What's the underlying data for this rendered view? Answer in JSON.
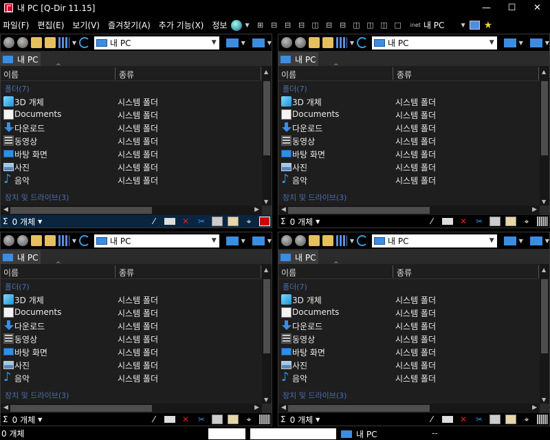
{
  "window": {
    "title": "내 PC  [Q-Dir 11.15]",
    "min": "—",
    "max": "☐",
    "close": "✕"
  },
  "menu": {
    "items": [
      "파일(F)",
      "편집(E)",
      "보기(V)",
      "즐겨찾기(A)",
      "추가 기능(X)",
      "정보"
    ],
    "pc_label": "내 PC"
  },
  "pane": {
    "address": "내 PC",
    "tab_label": "내 PC",
    "col_name": "이름",
    "col_type": "종류",
    "group_folders": "폴더(7)",
    "group_drives": "장치 및 드라이브(3)",
    "rows": [
      {
        "name": "3D 개체",
        "type": "시스템 폴더",
        "icon": "cube"
      },
      {
        "name": "Documents",
        "type": "시스템 폴더",
        "icon": "doc"
      },
      {
        "name": "다운로드",
        "type": "시스템 폴더",
        "icon": "down"
      },
      {
        "name": "동영상",
        "type": "시스템 폴더",
        "icon": "film"
      },
      {
        "name": "바탕 화면",
        "type": "시스템 폴더",
        "icon": "desk"
      },
      {
        "name": "사진",
        "type": "시스템 폴더",
        "icon": "pic"
      },
      {
        "name": "음악",
        "type": "시스템 폴더",
        "icon": "music"
      }
    ],
    "sigma": "Σ",
    "status_count": "0 개체"
  },
  "bottom": {
    "count": "0 개체",
    "pc": "내 PC",
    "dash": "--"
  }
}
